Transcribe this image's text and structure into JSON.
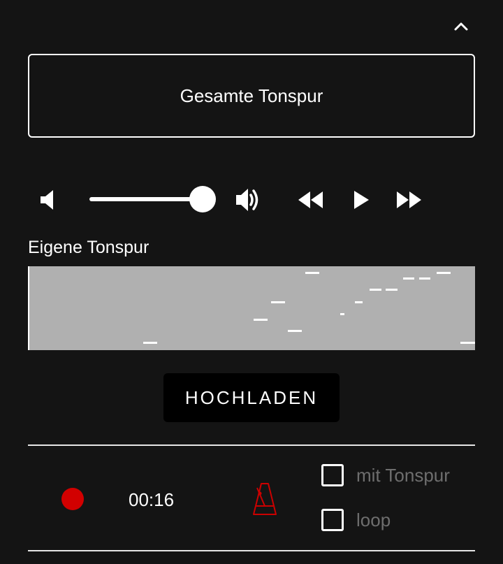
{
  "header": {
    "collapse_icon": "chevron-up-icon"
  },
  "track_selector": {
    "label": "Gesamte Tonspur"
  },
  "player": {
    "volume_level": 1.0,
    "icons": {
      "volume_low": "volume-low-icon",
      "volume_high": "volume-high-icon",
      "rewind": "rewind-icon",
      "play": "play-icon",
      "fast_forward": "fast-forward-icon"
    }
  },
  "own_track": {
    "label": "Eigene Tonspur",
    "roll_color": "#b0b0b0"
  },
  "upload": {
    "label": "HOCHLADEN"
  },
  "recorder": {
    "record_color": "#d20000",
    "time": "00:16",
    "metronome_icon": "metronome-icon",
    "metronome_color": "#cc0000",
    "options": [
      {
        "label": "mit Tonspur",
        "checked": false
      },
      {
        "label": "loop",
        "checked": false
      }
    ]
  }
}
